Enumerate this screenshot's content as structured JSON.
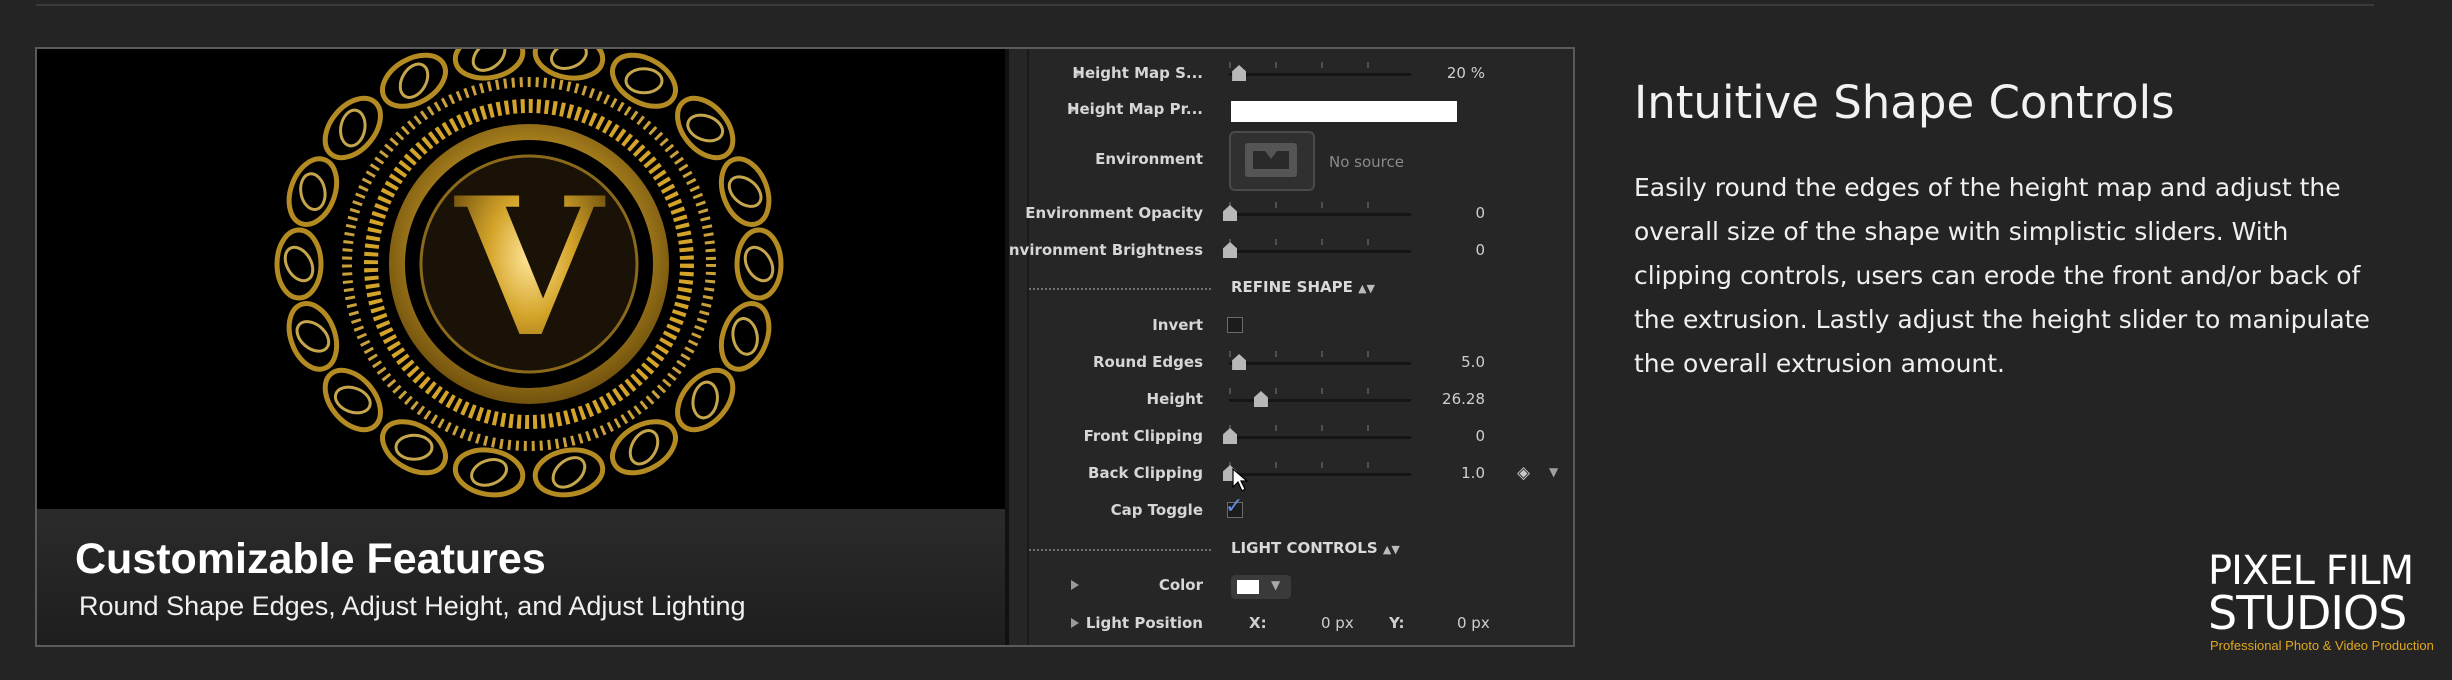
{
  "preview": {
    "caption_title": "Customizable Features",
    "caption_subtitle": "Round Shape Edges, Adjust Height, and Adjust Lighting",
    "gold": "#d4a42a"
  },
  "inspector": {
    "height_map_scale": {
      "label": "Height Map S...",
      "value": "20 %",
      "level": 0.05
    },
    "height_map_preview": {
      "label": "Height Map Pr..."
    },
    "environment": {
      "label": "Environment",
      "source": "No source"
    },
    "environment_opacity": {
      "label": "Environment Opacity",
      "value": "0",
      "level": 0.0
    },
    "environment_brightness": {
      "label": "Environment Brightness",
      "value": "0",
      "level": 0.0
    },
    "refine_shape": {
      "label": "REFINE SHAPE"
    },
    "invert": {
      "label": "Invert",
      "checked": false
    },
    "round_edges": {
      "label": "Round Edges",
      "value": "5.0",
      "level": 0.05
    },
    "height": {
      "label": "Height",
      "value": "26.28",
      "level": 0.17
    },
    "front_clipping": {
      "label": "Front Clipping",
      "value": "0",
      "level": 0.0
    },
    "back_clipping": {
      "label": "Back Clipping",
      "value": "1.0",
      "level": 0.0
    },
    "cap_toggle": {
      "label": "Cap Toggle",
      "checked": true
    },
    "light_controls": {
      "label": "LIGHT CONTROLS"
    },
    "color": {
      "label": "Color",
      "value": "#ffffff"
    },
    "light_position": {
      "label": "Light Position",
      "x_label": "X:",
      "x_value": "0 px",
      "y_label": "Y:",
      "y_value": "0 px"
    }
  },
  "content": {
    "headline": "Intuitive Shape Controls",
    "body": "Easily round the edges of the height map and adjust the overall size of the shape with simplistic sliders.  With clipping controls, users can erode the front and/or back of the extrusion.  Lastly adjust the height slider to manipulate the overall extrusion amount."
  },
  "logo": {
    "line1": "PIXEL FILM",
    "line2": "STUDIOS",
    "tagline": "Professional Photo & Video Production",
    "accent": "#e0a820"
  }
}
